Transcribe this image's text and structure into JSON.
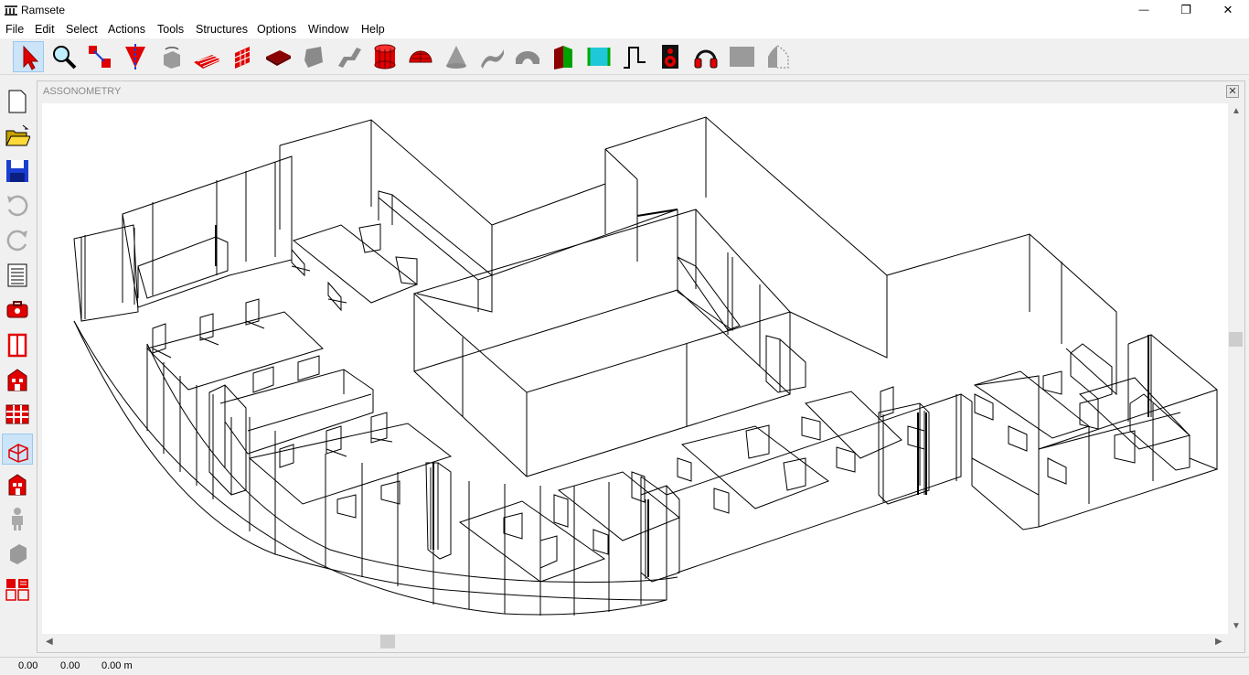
{
  "window": {
    "title": "Ramsete",
    "minimize_glyph": "—",
    "restore_glyph": "❐",
    "close_glyph": "✕"
  },
  "menu": [
    {
      "label": "File"
    },
    {
      "label": "Edit"
    },
    {
      "label": "Select"
    },
    {
      "label": "Actions"
    },
    {
      "label": "Tools"
    },
    {
      "label": "Structures"
    },
    {
      "label": "Options"
    },
    {
      "label": "Window"
    },
    {
      "label": "Help"
    }
  ],
  "toolbar": {
    "tools": [
      "select-arrow-icon",
      "zoom-magnifier-icon",
      "move-points-icon",
      "cut-plane-icon",
      "rotate-view-icon",
      "floor-grid-icon",
      "brick-wall-icon",
      "slab-icon",
      "polygon-surface-icon",
      "bent-surface-icon",
      "cylinder-icon",
      "dome-icon",
      "cone-icon",
      "curved-surface-icon",
      "arch-icon",
      "door-icon",
      "window-icon",
      "step-profile-icon",
      "speaker-icon",
      "headphones-icon",
      "panel-icon",
      "listener-shape-icon"
    ]
  },
  "sidebar": {
    "tools": [
      "new-document-icon",
      "open-folder-icon",
      "save-disk-icon",
      "undo-icon",
      "redo-icon",
      "list-report-icon",
      "toolbox-icon",
      "door-frame-icon",
      "building-icon",
      "grid-facade-icon",
      "house-wireframe-icon",
      "building-small-icon",
      "person-icon",
      "solid-block-icon",
      "building-group-icon"
    ]
  },
  "document": {
    "title": "ASSONOMETRY",
    "close_glyph": "✕"
  },
  "scroll": {
    "up": "▲",
    "down": "▼",
    "left": "◀",
    "right": "▶"
  },
  "status": {
    "x": "0.00",
    "y": "0.00",
    "z": "0.00 m"
  }
}
